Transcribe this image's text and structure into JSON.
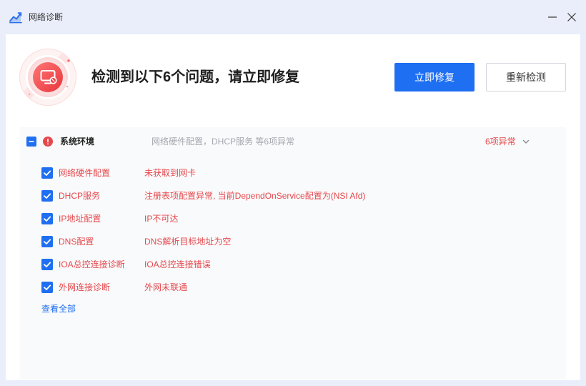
{
  "window": {
    "title": "网络诊断"
  },
  "header": {
    "title": "检测到以下6个问题，请立即修复",
    "fix_button": "立即修复",
    "recheck_button": "重新检测"
  },
  "group": {
    "title": "系统环境",
    "summary": "网络硬件配置，DHCP服务 等6项异常",
    "count_label": "6项异常",
    "indeterminate": true,
    "items": [
      {
        "label": "网络硬件配置",
        "detail": "未获取到网卡",
        "checked": true
      },
      {
        "label": "DHCP服务",
        "detail": "注册表项配置异常, 当前DependOnService配置为(NSI Afd)",
        "checked": true
      },
      {
        "label": "IP地址配置",
        "detail": "IP不可达",
        "checked": true
      },
      {
        "label": "DNS配置",
        "detail": "DNS解析目标地址为空",
        "checked": true
      },
      {
        "label": "IOA总控连接诊断",
        "detail": "IOA总控连接错误",
        "checked": true
      },
      {
        "label": "外网连接诊断",
        "detail": "外网未联通",
        "checked": true
      }
    ],
    "view_all": "查看全部"
  },
  "icons": {
    "app": "network-chart-icon",
    "minimize": "minimize-icon",
    "close": "close-icon",
    "status": "monitor-error-icon",
    "group_alert": "alert-circle-icon",
    "group_select": "minus-icon",
    "item_check": "checkmark-icon",
    "expand": "chevron-down-icon"
  },
  "colors": {
    "accent": "#1f6ff2",
    "danger": "#e5484d",
    "window_bg": "#e9eefa",
    "section_bg": "#f9fafb"
  }
}
